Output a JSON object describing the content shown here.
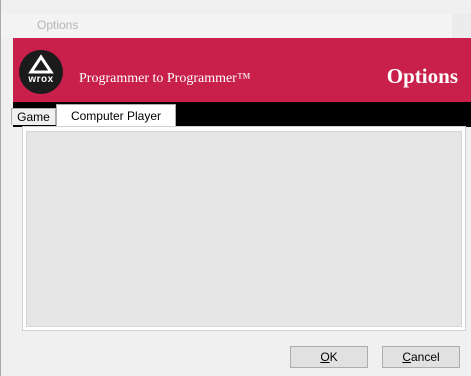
{
  "window": {
    "title": "Options"
  },
  "banner": {
    "logo_text": "wrox",
    "tagline": "Programmer to Programmer™",
    "heading": "Options"
  },
  "tabs": [
    {
      "label": "Game",
      "selected": false
    },
    {
      "label": "Computer Player",
      "selected": true
    }
  ],
  "buttons": {
    "ok": {
      "mnemonic": "O",
      "rest": "K"
    },
    "cancel": {
      "mnemonic": "C",
      "rest": "ancel"
    }
  },
  "colors": {
    "banner_red": "#c8204a",
    "panel_gray": "#e6e6e6"
  }
}
